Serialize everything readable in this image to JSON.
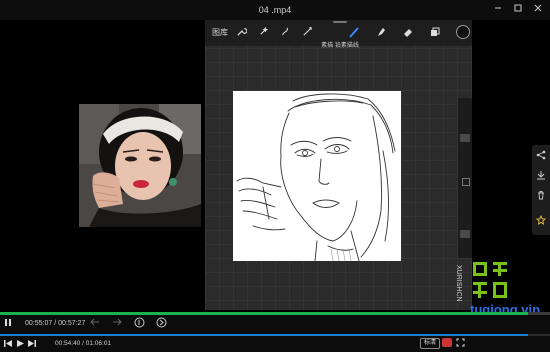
{
  "window": {
    "title": "04 .mp4"
  },
  "procreate": {
    "gallery_label": "图库",
    "sub_label": "素描 铅素描线",
    "watermark_vertical": "XURISHCN"
  },
  "reference_photo": {
    "description": ""
  },
  "player": {
    "time_current": "00:55:07",
    "time_total": "00:57:27",
    "time_current2": "00:54:40",
    "time_total2": "01:06:01",
    "progress": 0.96,
    "quality_badge": "标清"
  },
  "watermark": {
    "text": "tuqiong.vip",
    "logo_text": "图穷联盟"
  },
  "colors": {
    "accent_green": "#19b44d",
    "accent_blue": "#1a7fd0",
    "watermark_blue": "#2d6fe0",
    "logo_green": "#79c21a"
  },
  "icons": {
    "procreate_tools": [
      "wrench-icon",
      "magic-wand-icon",
      "selection-icon",
      "transform-icon",
      "brush-icon",
      "smudge-icon",
      "eraser-icon",
      "layers-icon"
    ],
    "right_panel": [
      "share-icon",
      "download-icon",
      "delete-icon",
      "favorite-icon"
    ]
  }
}
